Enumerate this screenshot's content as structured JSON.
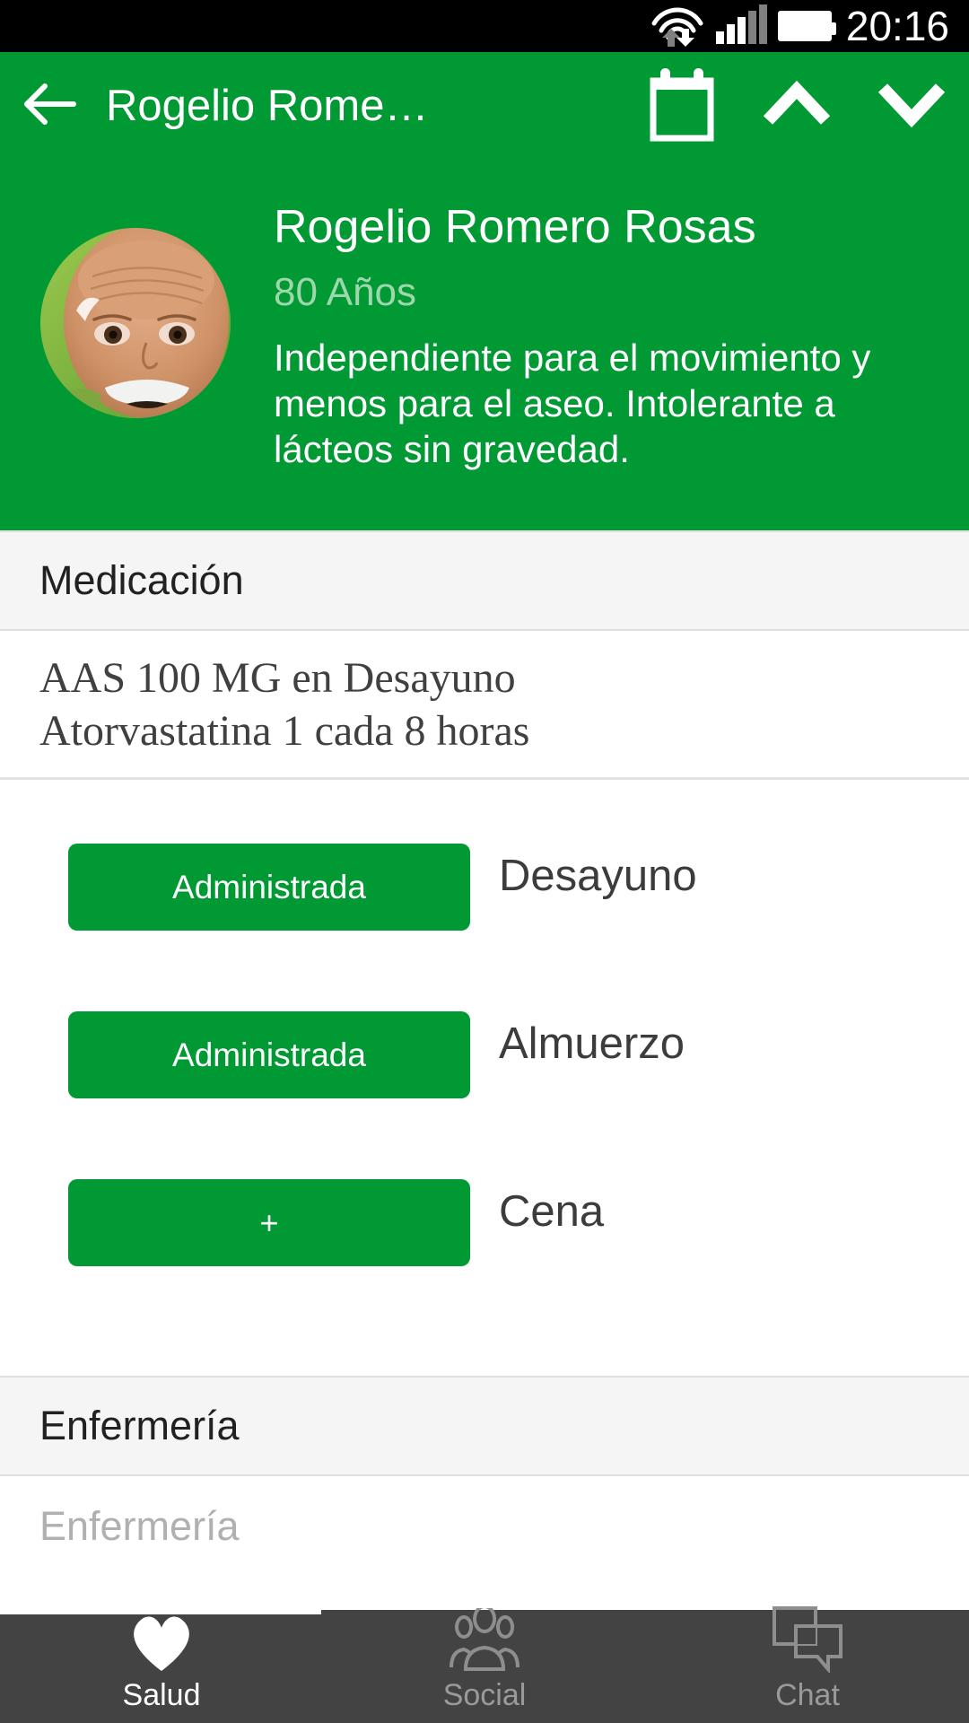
{
  "status_bar": {
    "time": "20:16",
    "icons": [
      "wifi-icon",
      "data-transfer-icon",
      "cell-signal-icon",
      "battery-icon"
    ]
  },
  "app_bar": {
    "back_icon": "back-arrow-icon",
    "title": "Rogelio Rome…",
    "calendar_icon": "calendar-icon",
    "prev_icon": "chevron-up-icon",
    "next_icon": "chevron-down-icon"
  },
  "profile": {
    "avatar_alt": "patient-photo",
    "name": "Rogelio Romero Rosas",
    "age": "80 Años",
    "description": "Independiente para el movimiento y menos para el aseo. Intolerante a lácteos sin gravedad."
  },
  "medication_section": {
    "header": "Medicación",
    "lines": [
      "AAS 100 MG en Desayuno",
      "Atorvastatina 1 cada 8 horas"
    ],
    "doses": [
      {
        "button": "Administrada",
        "label": "Desayuno",
        "state": "administered"
      },
      {
        "button": "Administrada",
        "label": "Almuerzo",
        "state": "administered"
      },
      {
        "button": "+",
        "label": "Cena",
        "state": "pending"
      }
    ]
  },
  "nursing_section": {
    "header": "Enfermería",
    "placeholder": "Enfermería"
  },
  "bottom_nav": {
    "items": [
      {
        "label": "Salud",
        "icon": "heart-icon",
        "active": true
      },
      {
        "label": "Social",
        "icon": "people-group-icon",
        "active": false
      },
      {
        "label": "Chat",
        "icon": "chat-bubbles-icon",
        "active": false
      }
    ]
  },
  "colors": {
    "brand_green": "#019934",
    "nav_dark": "#434343",
    "section_bg": "#f5f5f5",
    "age_text": "#9ed7ab",
    "placeholder": "#b0b0b0"
  }
}
